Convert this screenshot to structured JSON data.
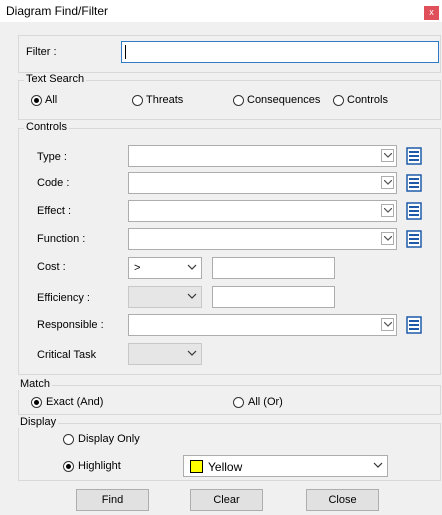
{
  "window": {
    "title": "Diagram Find/Filter",
    "close_glyph": "x"
  },
  "filter": {
    "label": "Filter :",
    "value": ""
  },
  "text_search": {
    "legend": "Text Search",
    "options": [
      "All",
      "Threats",
      "Consequences",
      "Controls"
    ],
    "selected": "All"
  },
  "controls": {
    "legend": "Controls",
    "type_label": "Type :",
    "code_label": "Code :",
    "effect_label": "Effect :",
    "function_label": "Function :",
    "cost_label": "Cost :",
    "cost_operator": ">",
    "cost_value": "",
    "efficiency_label": "Efficiency :",
    "efficiency_operator": "",
    "efficiency_value": "",
    "responsible_label": "Responsible :",
    "critical_task_label": "Critical Task",
    "critical_task_value": "",
    "picker_icon": "list-picker-icon"
  },
  "match": {
    "legend": "Match",
    "exact_label": "Exact (And)",
    "all_label": "All (Or)",
    "selected": "Exact (And)"
  },
  "display": {
    "legend": "Display",
    "display_only_label": "Display Only",
    "highlight_label": "Highlight",
    "selected": "Highlight",
    "highlight_color_name": "Yellow",
    "highlight_color": "#ffff00"
  },
  "buttons": {
    "find": "Find",
    "clear": "Clear",
    "close": "Close"
  },
  "colors": {
    "focus_border": "#2f79c7",
    "close_button": "#e0505a",
    "picker_icon": "#1e5aa8"
  }
}
